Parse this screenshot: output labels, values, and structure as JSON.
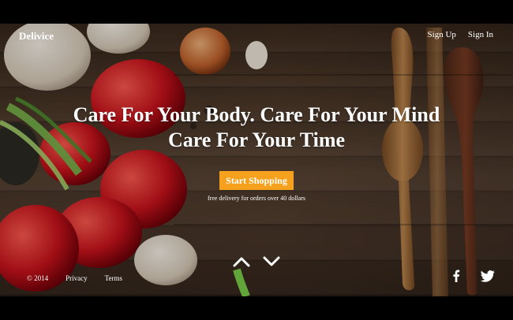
{
  "brand": {
    "name": "Delivice"
  },
  "nav": {
    "signup": "Sign Up",
    "signin": "Sign In"
  },
  "hero": {
    "line1": "Care For Your Body. Care For Your Mind",
    "line2": "Care For Your Time",
    "cta": "Start Shopping",
    "subtext": "free delivery for orders over 40 dollars"
  },
  "footer": {
    "copyright": "© 2014",
    "privacy": "Privacy",
    "terms": "Terms"
  },
  "icons": {
    "up": "chevron-up-icon",
    "down": "chevron-down-icon",
    "facebook": "facebook-icon",
    "twitter": "twitter-icon"
  },
  "colors": {
    "accent": "#f5a11d",
    "text": "#ffffff",
    "background": "#000000"
  }
}
